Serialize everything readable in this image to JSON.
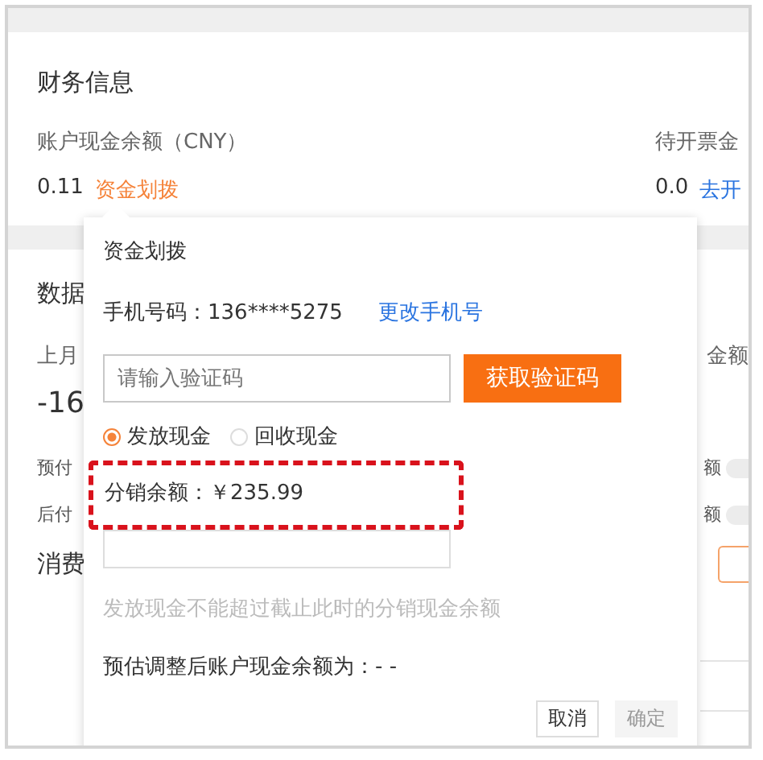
{
  "finance": {
    "title": "财务信息",
    "columns": [
      {
        "label": "账户现金余额（CNY）",
        "value": "0.11",
        "link": "资金划拨",
        "kind": "orange"
      },
      {
        "label": "待开票金",
        "value": "0.0",
        "link": "去开",
        "kind": "blue"
      }
    ]
  },
  "data_card": {
    "title": "数据",
    "month_label": "上月",
    "right_label": "金额",
    "amount": "-16",
    "rows": [
      {
        "label": "预付",
        "right": "额",
        "on": false
      },
      {
        "label": "后付",
        "right": "额",
        "on": false
      }
    ],
    "last_label": "消费"
  },
  "popover": {
    "title": "资金划拨",
    "phone_label": "手机号码：136****5275",
    "change_link": "更改手机号",
    "code_placeholder": "请输入验证码",
    "get_code_button": "获取验证码",
    "radios": [
      {
        "label": "发放现金",
        "selected": true
      },
      {
        "label": "回收现金",
        "selected": false
      }
    ],
    "balance": "分销余额：￥235.99",
    "hint": "发放现金不能超过截止此时的分销现金余额",
    "estimate": "预估调整后账户现金余额为：- -",
    "buttons": [
      {
        "label": "取消",
        "disabled": false
      },
      {
        "label": "确定",
        "disabled": true
      }
    ]
  }
}
